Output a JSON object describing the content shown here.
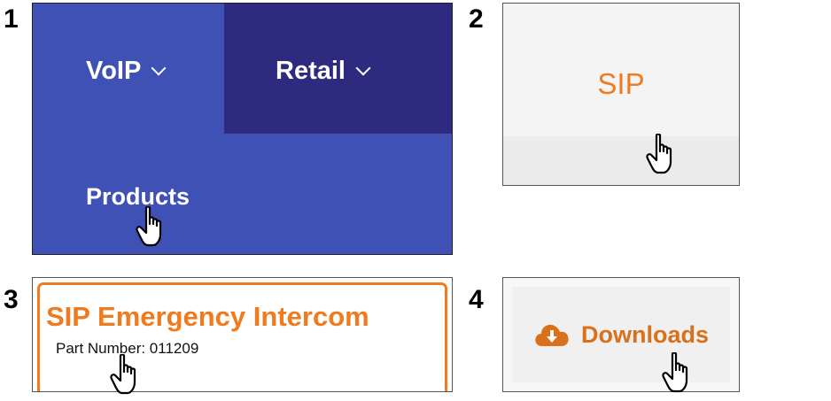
{
  "steps": [
    "1",
    "2",
    "3",
    "4"
  ],
  "panel1": {
    "menu_voip": "VoIP",
    "menu_retail": "Retail",
    "products": "Products"
  },
  "panel2": {
    "sip": "SIP"
  },
  "panel3": {
    "title": "SIP Emergency Intercom",
    "part_number": "Part Number: 011209"
  },
  "panel4": {
    "downloads": "Downloads"
  },
  "icons": [
    "chevron-down-icon",
    "hand-cursor-icon",
    "cloud-download-icon"
  ],
  "colors": {
    "nav_blue": "#3f51b5",
    "nav_dark": "#2d2a80",
    "accent_orange": "#f07b1e"
  }
}
